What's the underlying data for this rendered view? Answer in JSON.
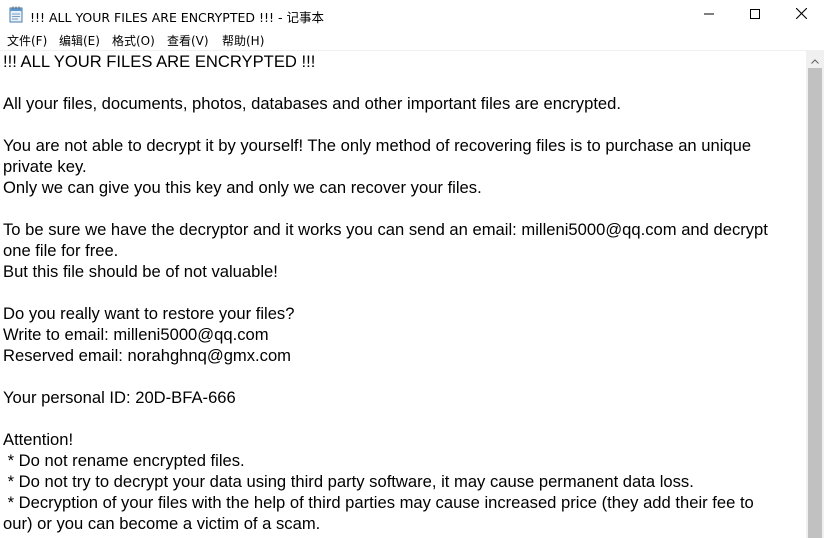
{
  "window": {
    "title": "!!! ALL YOUR FILES ARE ENCRYPTED !!! - 记事本",
    "icon": "notepad-icon",
    "minimize_icon": "minimize-icon",
    "maximize_icon": "maximize-icon",
    "close_icon": "close-icon"
  },
  "menu": {
    "items": [
      {
        "label": "文件(F)"
      },
      {
        "label": "编辑(E)"
      },
      {
        "label": "格式(O)"
      },
      {
        "label": "查看(V)"
      },
      {
        "label": "帮助(H)"
      }
    ]
  },
  "document": {
    "lines": [
      "!!! ALL YOUR FILES ARE ENCRYPTED !!!",
      "",
      "All your files, documents, photos, databases and other important files are encrypted.",
      "",
      "You are not able to decrypt it by yourself! The only method of recovering files is to purchase an unique",
      "private key.",
      "Only we can give you this key and only we can recover your files.",
      "",
      "To be sure we have the decryptor and it works you can send an email: milleni5000@qq.com and decrypt",
      "one file for free.",
      "But this file should be of not valuable!",
      "",
      "Do you really want to restore your files?",
      "Write to email: milleni5000@qq.com",
      "Reserved email: norahghnq@gmx.com",
      "",
      "Your personal ID: 20D-BFA-666",
      "",
      "Attention!",
      " * Do not rename encrypted files.",
      " * Do not try to decrypt your data using third party software, it may cause permanent data loss.",
      " * Decryption of your files with the help of third parties may cause increased price (they add their fee to",
      "our) or you can become a victim of a scam."
    ]
  }
}
